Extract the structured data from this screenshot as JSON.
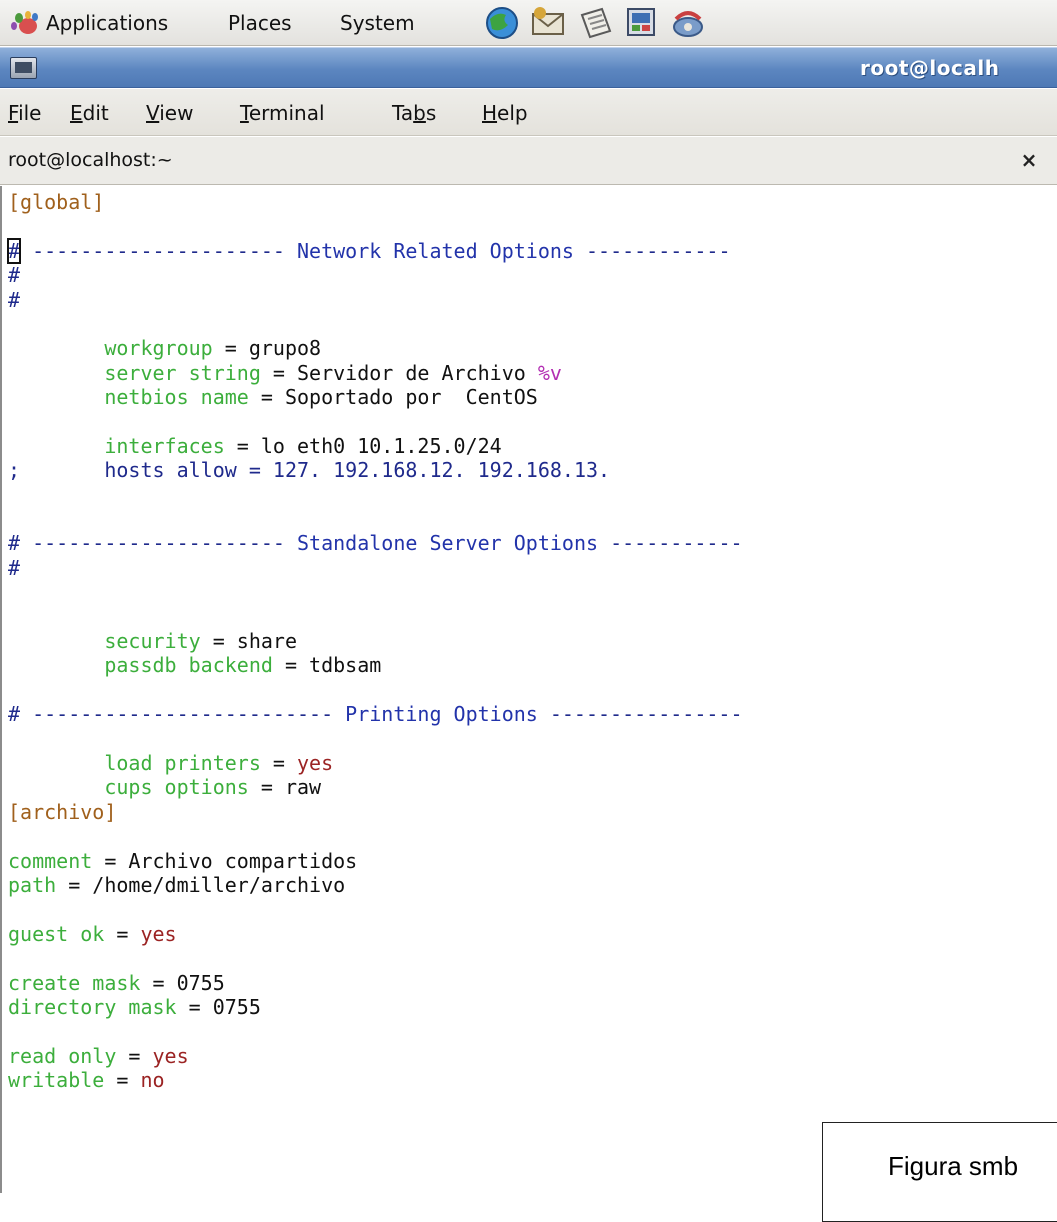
{
  "panel": {
    "menus": [
      "Applications",
      "Places",
      "System"
    ],
    "launchers": [
      "web-browser-icon",
      "email-client-icon",
      "notes-icon",
      "office-app-icon",
      "network-icon"
    ]
  },
  "window": {
    "title": "root@localh",
    "menus": [
      "File",
      "Edit",
      "View",
      "Terminal",
      "Tabs",
      "Help"
    ],
    "menu_mnemonics": [
      "F",
      "E",
      "V",
      "T",
      "b",
      "H"
    ]
  },
  "tab": {
    "label": "root@localhost:~",
    "close_glyph": "×"
  },
  "terminal": {
    "lines": [
      [
        {
          "t": "[global]",
          "c": "sec"
        }
      ],
      [],
      [
        {
          "t": "#",
          "c": "cm cursor"
        },
        {
          "t": " --------------------- ",
          "c": "cm"
        },
        {
          "t": "Network Related Options",
          "c": "hd"
        },
        {
          "t": " ------------",
          "c": "cm"
        }
      ],
      [
        {
          "t": "#",
          "c": "cm"
        }
      ],
      [
        {
          "t": "#",
          "c": "cm"
        }
      ],
      [],
      [
        {
          "t": "        "
        },
        {
          "t": "workgroup",
          "c": "ky"
        },
        {
          "t": " = grupo8",
          "c": "vl"
        }
      ],
      [
        {
          "t": "        "
        },
        {
          "t": "server string",
          "c": "ky"
        },
        {
          "t": " = Servidor de Archivo ",
          "c": "vl"
        },
        {
          "t": "%v",
          "c": "pv"
        }
      ],
      [
        {
          "t": "        "
        },
        {
          "t": "netbios name",
          "c": "ky"
        },
        {
          "t": " = Soportado por  CentOS",
          "c": "vl"
        }
      ],
      [],
      [
        {
          "t": "        "
        },
        {
          "t": "interfaces",
          "c": "ky"
        },
        {
          "t": " = lo eth0 10.1.25.0/24",
          "c": "vl"
        }
      ],
      [
        {
          "t": ";",
          "c": "cm"
        },
        {
          "t": "       "
        },
        {
          "t": "hosts allow = 127. 192.168.12. 192.168.13.",
          "c": "cm"
        }
      ],
      [],
      [],
      [
        {
          "t": "#",
          "c": "cm"
        },
        {
          "t": " --------------------- ",
          "c": "cm"
        },
        {
          "t": "Standalone Server Options",
          "c": "hd"
        },
        {
          "t": " -----------",
          "c": "cm"
        }
      ],
      [
        {
          "t": "#",
          "c": "cm"
        }
      ],
      [],
      [],
      [
        {
          "t": "        "
        },
        {
          "t": "security",
          "c": "ky"
        },
        {
          "t": " = share",
          "c": "vl"
        }
      ],
      [
        {
          "t": "        "
        },
        {
          "t": "passdb backend",
          "c": "ky"
        },
        {
          "t": " = tdbsam",
          "c": "vl"
        }
      ],
      [],
      [
        {
          "t": "#",
          "c": "cm"
        },
        {
          "t": " ------------------------- ",
          "c": "cm"
        },
        {
          "t": "Printing Options",
          "c": "hd"
        },
        {
          "t": " ----------------",
          "c": "cm"
        }
      ],
      [],
      [
        {
          "t": "        "
        },
        {
          "t": "load printers",
          "c": "ky"
        },
        {
          "t": " = ",
          "c": "vl"
        },
        {
          "t": "yes",
          "c": "ye"
        }
      ],
      [
        {
          "t": "        "
        },
        {
          "t": "cups options",
          "c": "ky"
        },
        {
          "t": " = raw",
          "c": "vl"
        }
      ],
      [
        {
          "t": "[archivo]",
          "c": "sec"
        }
      ],
      [],
      [
        {
          "t": "comment",
          "c": "ky"
        },
        {
          "t": " = Archivo compartidos",
          "c": "vl"
        }
      ],
      [
        {
          "t": "path",
          "c": "ky"
        },
        {
          "t": " = /home/dmiller/archivo",
          "c": "vl"
        }
      ],
      [],
      [
        {
          "t": "guest ok",
          "c": "ky"
        },
        {
          "t": " = ",
          "c": "vl"
        },
        {
          "t": "yes",
          "c": "ye"
        }
      ],
      [],
      [
        {
          "t": "create mask",
          "c": "ky"
        },
        {
          "t": " = 0755",
          "c": "vl"
        }
      ],
      [
        {
          "t": "directory mask",
          "c": "ky"
        },
        {
          "t": " = 0755",
          "c": "vl"
        }
      ],
      [],
      [
        {
          "t": "read only",
          "c": "ky"
        },
        {
          "t": " = ",
          "c": "vl"
        },
        {
          "t": "yes",
          "c": "ye"
        }
      ],
      [
        {
          "t": "writable",
          "c": "ky"
        },
        {
          "t": " = ",
          "c": "vl"
        },
        {
          "t": "no",
          "c": "ye"
        }
      ]
    ]
  },
  "caption": {
    "text": "Figura smb"
  },
  "colors": {
    "title_bar": "#5c86c0",
    "section": "#a0601c",
    "comment": "#1f2a8c",
    "key": "#3cae3c",
    "yes_value": "#9b2323",
    "macro": "#b32fb3"
  }
}
